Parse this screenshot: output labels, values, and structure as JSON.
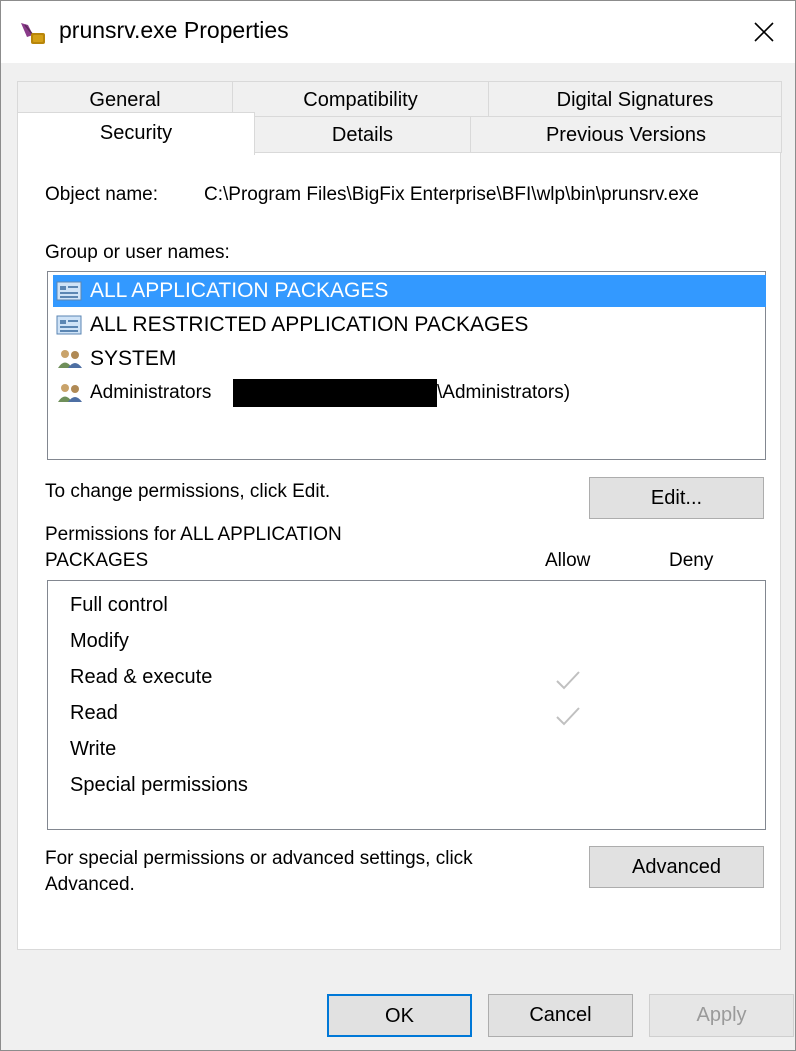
{
  "window": {
    "title": "prunsrv.exe Properties"
  },
  "tabs": {
    "back_row": [
      "General",
      "Compatibility",
      "Digital Signatures"
    ],
    "front_row": [
      "Security",
      "Details",
      "Previous Versions"
    ],
    "active": "Security"
  },
  "security": {
    "object_name_label": "Object name:",
    "object_name_value": "C:\\Program Files\\BigFix Enterprise\\BFI\\wlp\\bin\\prunsrv.exe",
    "group_label": "Group or user names:",
    "groups": [
      {
        "label": "ALL APPLICATION PACKAGES",
        "icon": "app-packages-icon",
        "selected": true
      },
      {
        "label": "ALL RESTRICTED APPLICATION PACKAGES",
        "icon": "app-packages-icon",
        "selected": false
      },
      {
        "label": "SYSTEM",
        "icon": "users-group-icon",
        "selected": false
      },
      {
        "label": "Administrators",
        "suffix": "\\Administrators)",
        "icon": "users-group-icon",
        "selected": false,
        "redacted": true
      }
    ],
    "change_hint": "To change permissions, click Edit.",
    "edit_button": "Edit...",
    "permissions_for_line1": "Permissions for ALL APPLICATION",
    "permissions_for_line2": "PACKAGES",
    "allow_header": "Allow",
    "deny_header": "Deny",
    "permissions": [
      {
        "name": "Full control",
        "allow": false,
        "deny": false
      },
      {
        "name": "Modify",
        "allow": false,
        "deny": false
      },
      {
        "name": "Read & execute",
        "allow": true,
        "deny": false
      },
      {
        "name": "Read",
        "allow": true,
        "deny": false
      },
      {
        "name": "Write",
        "allow": false,
        "deny": false
      },
      {
        "name": "Special permissions",
        "allow": false,
        "deny": false
      }
    ],
    "advanced_hint_line1": "For special permissions or advanced settings, click",
    "advanced_hint_line2": "Advanced.",
    "advanced_button": "Advanced"
  },
  "footer": {
    "ok": "OK",
    "cancel": "Cancel",
    "apply": "Apply"
  },
  "colors": {
    "selection": "#3399ff",
    "primary_border": "#0078d7",
    "check": "#c0c0c0"
  }
}
